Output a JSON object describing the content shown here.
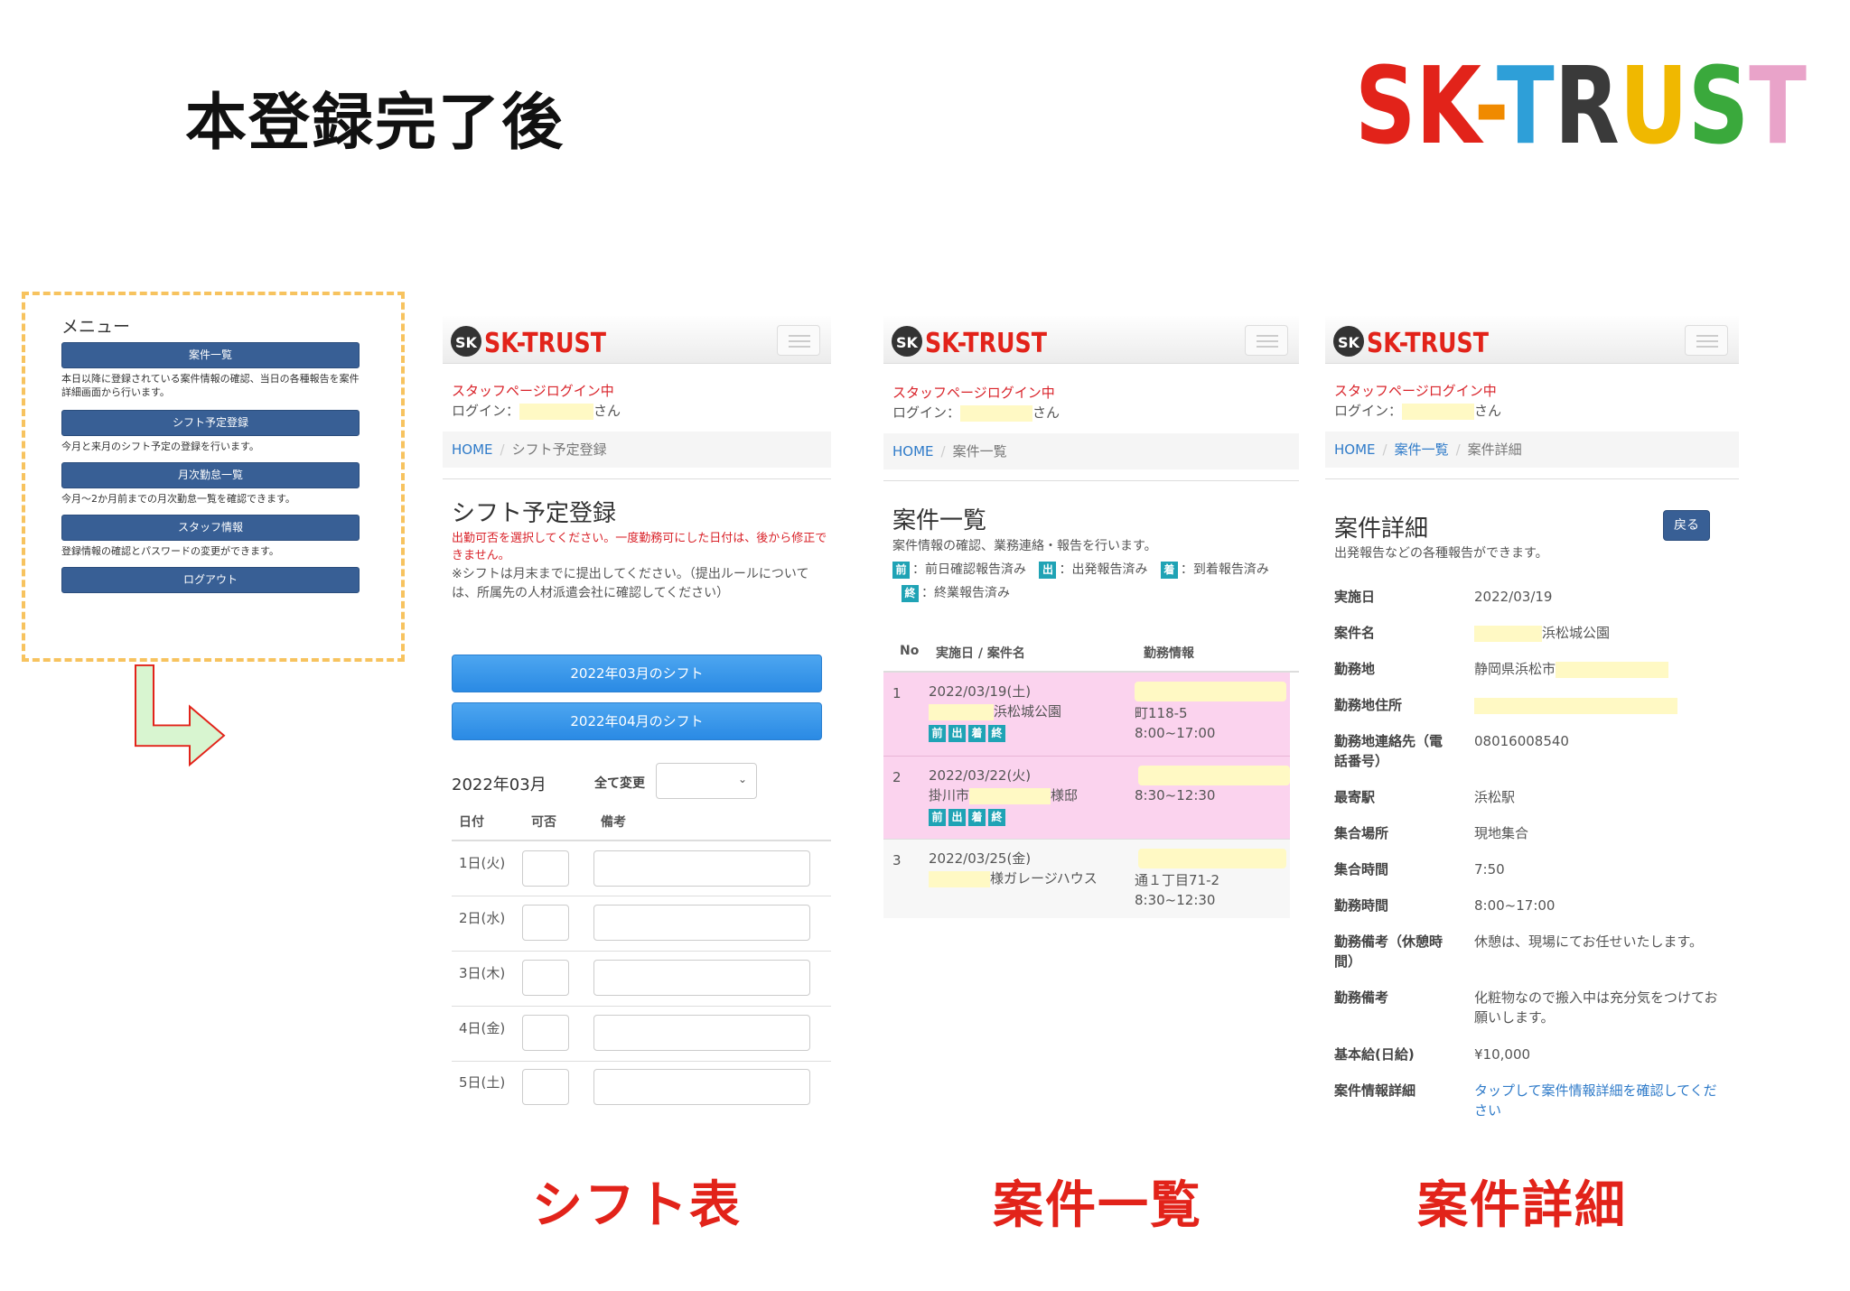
{
  "heading": "本登録完了後",
  "brand": "SK-TRUST",
  "captions": {
    "shift": "シフト表",
    "list": "案件一覧",
    "detail": "案件詳細"
  },
  "menu": {
    "title": "メニュー",
    "items": [
      {
        "label": "案件一覧",
        "desc": "本日以降に登録されている案件情報の確認、当日の各種報告を案件詳細画面から行います。"
      },
      {
        "label": "シフト予定登録",
        "desc": "今月と来月のシフト予定の登録を行います。"
      },
      {
        "label": "月次勤怠一覧",
        "desc": "今月～2か月前までの月次勤怠一覧を確認できます。"
      },
      {
        "label": "スタッフ情報",
        "desc": "登録情報の確認とパスワードの変更ができます。"
      },
      {
        "label": "ログアウト",
        "desc": ""
      }
    ]
  },
  "common": {
    "logo_text": "SK-TRUST",
    "login_status": "スタッフページログイン中",
    "login_prefix": "ログイン：",
    "login_suffix": "さん",
    "home": "HOME"
  },
  "shift": {
    "crumb": "シフト予定登録",
    "title": "シフト予定登録",
    "warning": "出勤可否を選択してください。一度勤務可にした日付は、後から修正できません。",
    "note": "※シフトは月末までに提出してください。（提出ルールについては、所属先の人材派遣会社に確認してください）",
    "buttons": [
      "2022年03月のシフト",
      "2022年04月のシフト"
    ],
    "month": "2022年03月",
    "change_all": "全て変更",
    "headers": {
      "date": "日付",
      "avail": "可否",
      "note": "備考"
    },
    "rows": [
      "1日(火)",
      "2日(水)",
      "3日(木)",
      "4日(金)",
      "5日(土)"
    ]
  },
  "list": {
    "crumb": "案件一覧",
    "title": "案件一覧",
    "desc": "案件情報の確認、業務連絡・報告を行います。",
    "legend": [
      {
        "badge": "前",
        "text": "：前日確認報告済み"
      },
      {
        "badge": "出",
        "text": "：出発報告済み"
      },
      {
        "badge": "着",
        "text": "：到着報告済み"
      },
      {
        "badge": "終",
        "text": "：終業報告済み"
      }
    ],
    "headers": {
      "no": "No",
      "date": "実施日 / 案件名",
      "info": "勤務情報"
    },
    "rows": [
      {
        "no": "1",
        "date": "2022/03/19(土)",
        "name": "浜松城公園",
        "addr": "町118-5",
        "time": "8:00~17:00",
        "badges": [
          "前",
          "出",
          "着",
          "終"
        ]
      },
      {
        "no": "2",
        "date": "2022/03/22(火)",
        "name_pre": "掛川市",
        "name": "様邸",
        "addr": "",
        "time": "8:30~12:30",
        "badges": [
          "前",
          "出",
          "着",
          "終"
        ]
      },
      {
        "no": "3",
        "date": "2022/03/25(金)",
        "name": "様ガレージハウス",
        "addr": "通１丁目71-2",
        "time": "8:30~12:30",
        "badges": []
      }
    ]
  },
  "detail": {
    "crumb_mid": "案件一覧",
    "crumb": "案件詳細",
    "title": "案件詳細",
    "desc": "出発報告などの各種報告ができます。",
    "back": "戻る",
    "fields": [
      {
        "label": "実施日",
        "value": "2022/03/19"
      },
      {
        "label": "案件名",
        "value": "浜松城公園"
      },
      {
        "label": "勤務地",
        "value": "静岡県浜松市"
      },
      {
        "label": "勤務地住所",
        "value": ""
      },
      {
        "label": "勤務地連絡先（電話番号）",
        "value": "08016008540"
      },
      {
        "label": "最寄駅",
        "value": "浜松駅"
      },
      {
        "label": "集合場所",
        "value": "現地集合"
      },
      {
        "label": "集合時間",
        "value": "7:50"
      },
      {
        "label": "勤務時間",
        "value": "8:00~17:00"
      },
      {
        "label": "勤務備考（休憩時間）",
        "value": "休憩は、現場にてお任せいたします。"
      },
      {
        "label": "勤務備考",
        "value": "化粧物なので搬入中は充分気をつけてお願いします。"
      },
      {
        "label": "基本給(日給)",
        "value": "¥10,000"
      },
      {
        "label": "案件情報詳細",
        "value": "タップして案件情報詳細を確認してください"
      }
    ]
  }
}
